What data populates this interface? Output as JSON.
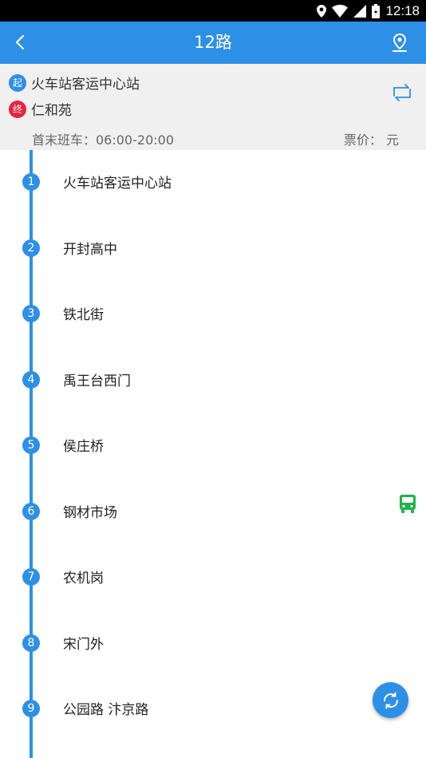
{
  "status_bar": {
    "time": "12:18"
  },
  "header": {
    "title": "12路"
  },
  "route_info": {
    "start_badge": "起",
    "start_station": "火车站客运中心站",
    "end_badge": "终",
    "end_station": "仁和苑",
    "schedule": "首末班车：06:00-20:00",
    "fare": "票价：  元"
  },
  "stops": [
    {
      "num": "1",
      "name": "火车站客运中心站"
    },
    {
      "num": "2",
      "name": "开封高中"
    },
    {
      "num": "3",
      "name": "铁北街"
    },
    {
      "num": "4",
      "name": "禹王台西门"
    },
    {
      "num": "5",
      "name": "侯庄桥"
    },
    {
      "num": "6",
      "name": "钢材市场"
    },
    {
      "num": "7",
      "name": "农机岗"
    },
    {
      "num": "8",
      "name": "宋门外"
    },
    {
      "num": "9",
      "name": "公园路 汴京路"
    }
  ],
  "colors": {
    "primary": "#2e8fe6",
    "end_badge": "#e8243a",
    "bus": "#22b14c"
  },
  "icons": [
    "back-arrow-icon",
    "map-pin-icon",
    "swap-icon",
    "bus-icon",
    "refresh-icon",
    "location-icon",
    "wifi-icon",
    "signal-icon",
    "battery-icon"
  ]
}
